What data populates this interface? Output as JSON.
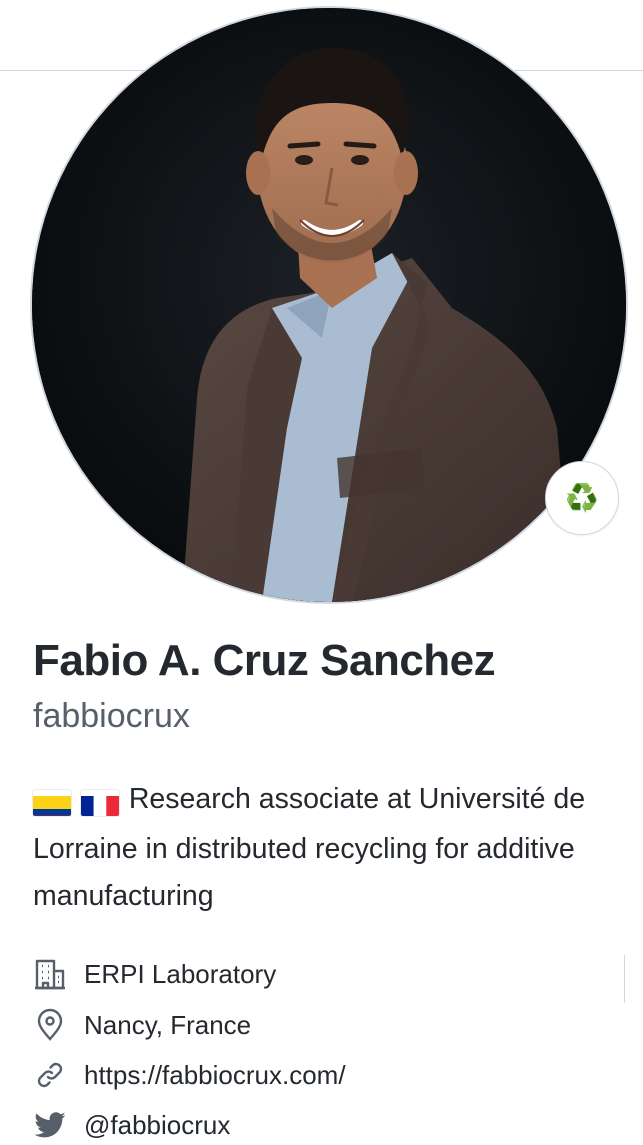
{
  "profile": {
    "fullname": "Fabio A. Cruz Sanchez",
    "username": "fabbiocrux",
    "status_emoji": "♻️",
    "bio_text": "Research associate at Université de Lorraine in distributed recycling for additive manufacturing",
    "bio_flags": [
      "colombia-flag",
      "france-flag"
    ]
  },
  "details": {
    "organization": "ERPI Laboratory",
    "location": "Nancy, France",
    "website": "https://fabbiocrux.com/",
    "twitter": "@fabbiocrux"
  },
  "icons": {
    "organization": "building-icon",
    "location": "location-pin-icon",
    "website": "link-icon",
    "twitter": "twitter-bird-icon",
    "status": "recycle-icon"
  },
  "colors": {
    "text": "#24292f",
    "muted": "#57606a",
    "border": "#d0d7de",
    "status_green": "#1f8f2e"
  }
}
